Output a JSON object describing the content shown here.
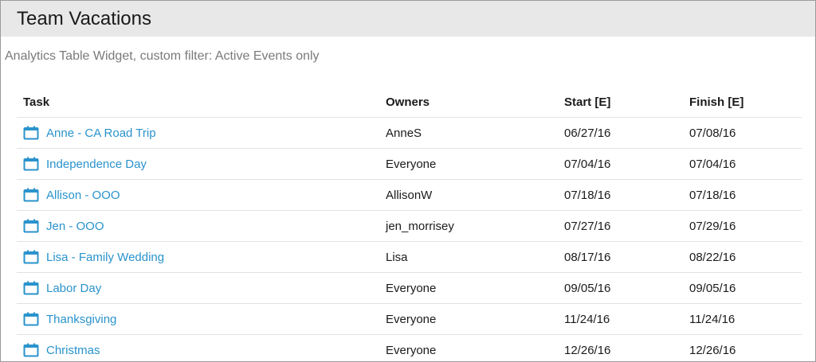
{
  "widget": {
    "title": "Team Vacations",
    "subtitle": "Analytics Table Widget, custom filter: Active Events only"
  },
  "colors": {
    "link": "#2a93cc",
    "header_bg": "#e8e8e8",
    "subtitle": "#7a7a7a"
  },
  "table": {
    "columns": {
      "task": "Task",
      "owners": "Owners",
      "start": "Start [E]",
      "finish": "Finish [E]"
    },
    "rows": [
      {
        "task": "Anne - CA Road Trip",
        "icon": "calendar-icon",
        "owners": "AnneS",
        "start": "06/27/16",
        "finish": "07/08/16"
      },
      {
        "task": "Independence Day",
        "icon": "calendar-icon",
        "owners": "Everyone",
        "start": "07/04/16",
        "finish": "07/04/16"
      },
      {
        "task": "Allison - OOO",
        "icon": "calendar-icon",
        "owners": "AllisonW",
        "start": "07/18/16",
        "finish": "07/18/16"
      },
      {
        "task": "Jen - OOO",
        "icon": "calendar-icon",
        "owners": "jen_morrisey",
        "start": "07/27/16",
        "finish": "07/29/16"
      },
      {
        "task": "Lisa - Family Wedding",
        "icon": "calendar-icon",
        "owners": "Lisa",
        "start": "08/17/16",
        "finish": "08/22/16"
      },
      {
        "task": "Labor Day",
        "icon": "calendar-icon",
        "owners": "Everyone",
        "start": "09/05/16",
        "finish": "09/05/16"
      },
      {
        "task": "Thanksgiving",
        "icon": "calendar-icon",
        "owners": "Everyone",
        "start": "11/24/16",
        "finish": "11/24/16"
      },
      {
        "task": "Christmas",
        "icon": "calendar-icon",
        "owners": "Everyone",
        "start": "12/26/16",
        "finish": "12/26/16"
      }
    ]
  }
}
